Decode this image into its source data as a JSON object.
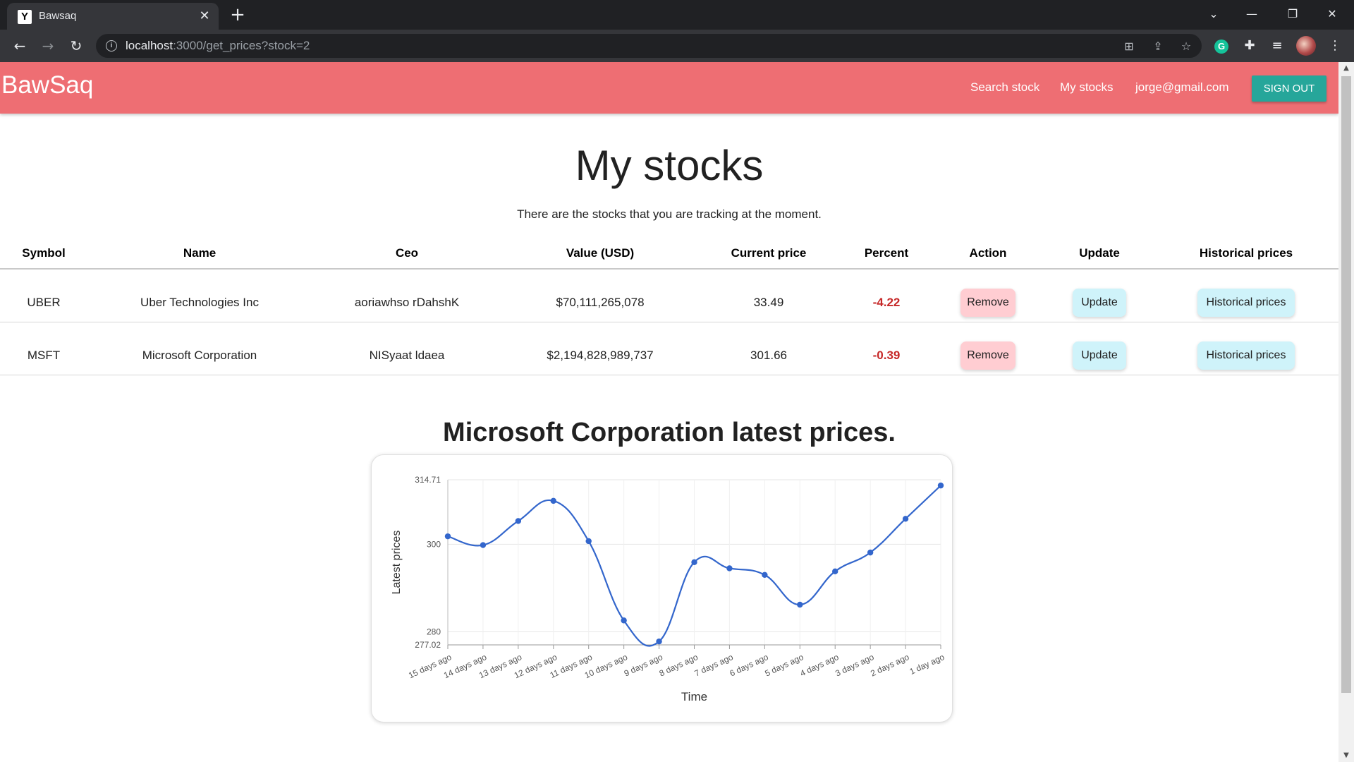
{
  "browser": {
    "tab_title": "Bawsaq",
    "tab_favicon_letter": "Y",
    "url_host": "localhost",
    "url_rest": ":3000/get_prices?stock=2"
  },
  "navbar": {
    "brand": "BawSaq",
    "links": [
      "Search stock",
      "My stocks",
      "jorge@gmail.com"
    ],
    "signout_label": "SIGN OUT"
  },
  "page": {
    "title": "My stocks",
    "subtitle": "There are the stocks that you are tracking at the moment."
  },
  "table": {
    "headers": [
      "Symbol",
      "Name",
      "Ceo",
      "Value (USD)",
      "Current price",
      "Percent",
      "Action",
      "Update",
      "Historical prices"
    ],
    "rows": [
      {
        "symbol": "UBER",
        "name": "Uber Technologies Inc",
        "ceo": "aoriawhso rDahshK",
        "value": "$70,111,265,078",
        "price": "33.49",
        "percent": "-4.22",
        "action": "Remove",
        "update": "Update",
        "historical": "Historical prices"
      },
      {
        "symbol": "MSFT",
        "name": "Microsoft Corporation",
        "ceo": "NISyaat ldaea",
        "value": "$2,194,828,989,737",
        "price": "301.66",
        "percent": "-0.39",
        "action": "Remove",
        "update": "Update",
        "historical": "Historical prices"
      }
    ]
  },
  "chart_section": {
    "company": "Microsoft Corporation",
    "suffix": " latest prices."
  },
  "chart_data": {
    "type": "line",
    "categories": [
      "15 days ago",
      "14 days ago",
      "13 days ago",
      "12 days ago",
      "11 days ago",
      "10 days ago",
      "9 days ago",
      "8 days ago",
      "7 days ago",
      "6 days ago",
      "5 days ago",
      "4 days ago",
      "3 days ago",
      "2 days ago",
      "1 day ago"
    ],
    "series": [
      {
        "values": [
          301.8,
          299.8,
          305.3,
          309.9,
          300.7,
          282.6,
          277.8,
          295.9,
          294.5,
          293.0,
          286.2,
          293.8,
          298.1,
          305.8,
          313.4
        ]
      }
    ],
    "xlabel": "Time",
    "ylabel": "Latest prices",
    "yticks": [
      "314.71",
      "300",
      "280",
      "277.02"
    ],
    "ylim": [
      277.02,
      314.71
    ],
    "color": "#3366cc",
    "grid": true
  }
}
